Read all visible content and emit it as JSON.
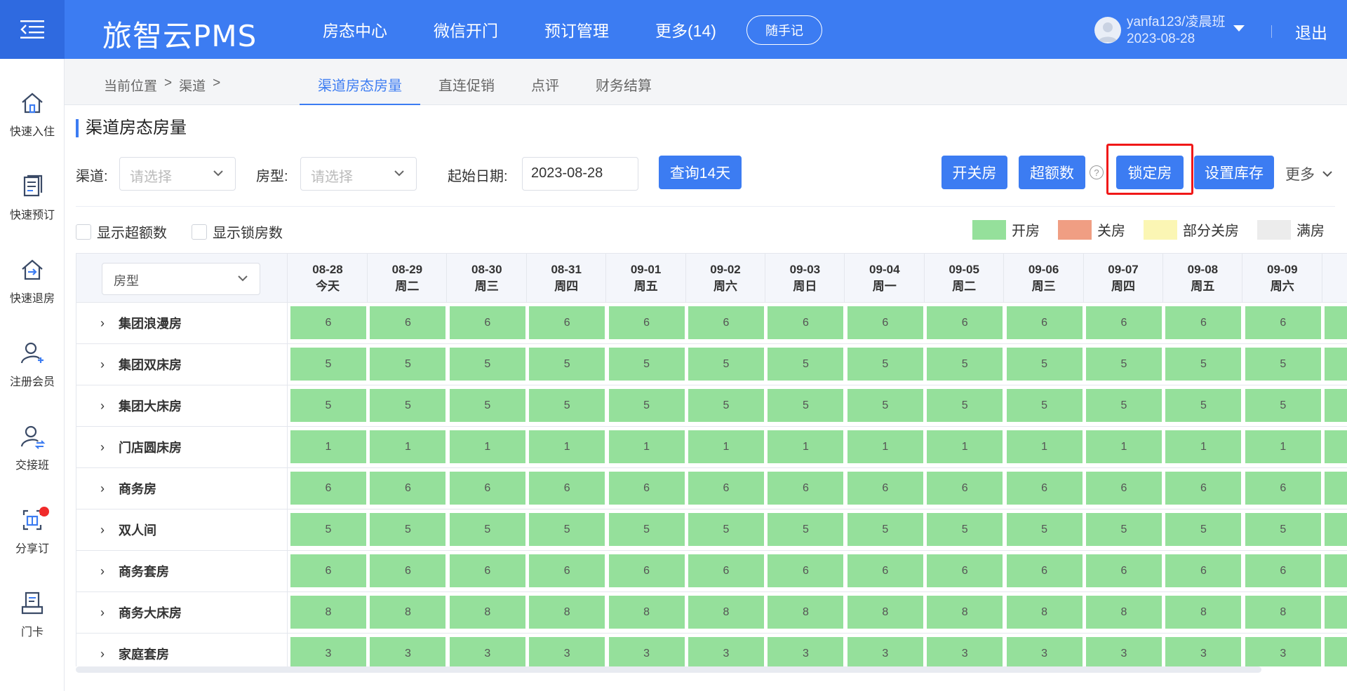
{
  "header": {
    "logo": "旅智云PMS",
    "nav": [
      "房态中心",
      "微信开门",
      "预订管理",
      "更多(14)"
    ],
    "memo": "随手记",
    "user": {
      "name": "yanfa123/凌晨班",
      "date": "2023-08-28"
    },
    "logout": "退出"
  },
  "sidebar": {
    "items": [
      {
        "label": "快速入住",
        "icon": "home-icon"
      },
      {
        "label": "快速预订",
        "icon": "booking-doc-icon"
      },
      {
        "label": "快速退房",
        "icon": "checkout-house-icon"
      },
      {
        "label": "注册会员",
        "icon": "user-add-icon"
      },
      {
        "label": "交接班",
        "icon": "user-switch-icon"
      },
      {
        "label": "分享订",
        "icon": "share-order-icon"
      },
      {
        "label": "门卡",
        "icon": "card-printer-icon"
      }
    ]
  },
  "breadcrumb": {
    "prefix": "当前位置",
    "sep1": ">",
    "item": "渠道",
    "sep2": ">"
  },
  "tabs": [
    "渠道房态房量",
    "直连促销",
    "点评",
    "财务结算"
  ],
  "page": {
    "title": "渠道房态房量"
  },
  "filters": {
    "channel_label": "渠道:",
    "channel_placeholder": "请选择",
    "room_label": "房型:",
    "room_placeholder": "请选择",
    "date_label": "起始日期:",
    "date_value": "2023-08-28",
    "query_button": "查询14天"
  },
  "actions": {
    "open_close": "开关房",
    "over_quota": "超额数",
    "lock_room": "锁定房",
    "set_stock": "设置库存",
    "more": "更多"
  },
  "checkboxes": {
    "show_over": "显示超额数",
    "show_lock": "显示锁房数"
  },
  "legend": [
    {
      "label": "开房",
      "color": "#95e09b"
    },
    {
      "label": "关房",
      "color": "#f09e83"
    },
    {
      "label": "部分关房",
      "color": "#fbf6b4"
    },
    {
      "label": "满房",
      "color": "#ececec"
    }
  ],
  "grid": {
    "room_filter": "房型",
    "dates": [
      {
        "date": "08-28",
        "day": "今天"
      },
      {
        "date": "08-29",
        "day": "周二"
      },
      {
        "date": "08-30",
        "day": "周三"
      },
      {
        "date": "08-31",
        "day": "周四"
      },
      {
        "date": "09-01",
        "day": "周五"
      },
      {
        "date": "09-02",
        "day": "周六"
      },
      {
        "date": "09-03",
        "day": "周日"
      },
      {
        "date": "09-04",
        "day": "周一"
      },
      {
        "date": "09-05",
        "day": "周二"
      },
      {
        "date": "09-06",
        "day": "周三"
      },
      {
        "date": "09-07",
        "day": "周四"
      },
      {
        "date": "09-08",
        "day": "周五"
      },
      {
        "date": "09-09",
        "day": "周六"
      }
    ],
    "rows": [
      {
        "name": "集团浪漫房",
        "value": "6"
      },
      {
        "name": "集团双床房",
        "value": "5"
      },
      {
        "name": "集团大床房",
        "value": "5"
      },
      {
        "name": "门店圆床房",
        "value": "1"
      },
      {
        "name": "商务房",
        "value": "6"
      },
      {
        "name": "双人间",
        "value": "5"
      },
      {
        "name": "商务套房",
        "value": "6"
      },
      {
        "name": "商务大床房",
        "value": "8"
      },
      {
        "name": "家庭套房",
        "value": "3"
      }
    ],
    "expand_glyph": "›",
    "open_color": "#95e09b"
  }
}
